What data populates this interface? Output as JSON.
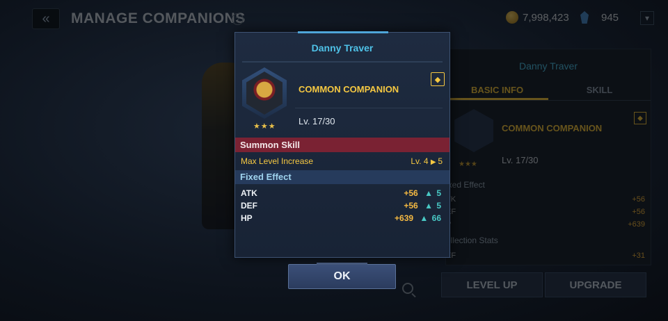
{
  "header": {
    "back_icon": "double-chevron-left-icon",
    "title": "MANAGE COMPANIONS",
    "help_label": "?",
    "gold_value": "7,998,423",
    "crystal_value": "945"
  },
  "side_panel": {
    "name": "Danny Traver",
    "tabs": [
      {
        "label": "BASIC INFO",
        "active": true
      },
      {
        "label": "SKILL",
        "active": false
      }
    ],
    "rarity": "COMMON COMPANION",
    "level": "Lv. 17/30",
    "stars": "★★★",
    "fixed_effect_title": "ixed Effect",
    "fixed_stats": [
      {
        "label": "TK",
        "value": "+56"
      },
      {
        "label": "EF",
        "value": "+56"
      },
      {
        "label": "P",
        "value": "+639"
      }
    ],
    "collection_title": "ollection Stats",
    "collection_stats": [
      {
        "label": "EF",
        "value": "+31"
      }
    ],
    "level_up_label": "LEVEL UP",
    "upgrade_label": "UPGRADE"
  },
  "modal": {
    "title": "Danny Traver",
    "rarity": "COMMON COMPANION",
    "level": "Lv. 17/30",
    "stars": "★★★",
    "summon_section": "Summon Skill",
    "summon_skill": {
      "name": "Max Level Increase",
      "from": "Lv. 4",
      "to": "5"
    },
    "fixed_section": "Fixed Effect",
    "stats": [
      {
        "label": "ATK",
        "value": "+56",
        "gain": "5"
      },
      {
        "label": "DEF",
        "value": "+56",
        "gain": "5"
      },
      {
        "label": "HP",
        "value": "+639",
        "gain": "66"
      }
    ],
    "ok_label": "OK"
  },
  "colors": {
    "accent_gold": "#f5c842",
    "title_cyan": "#4fc2e8",
    "summon_bar": "#7a2233",
    "fixed_bar": "#263b5c",
    "gain_teal": "#49c8c4"
  }
}
